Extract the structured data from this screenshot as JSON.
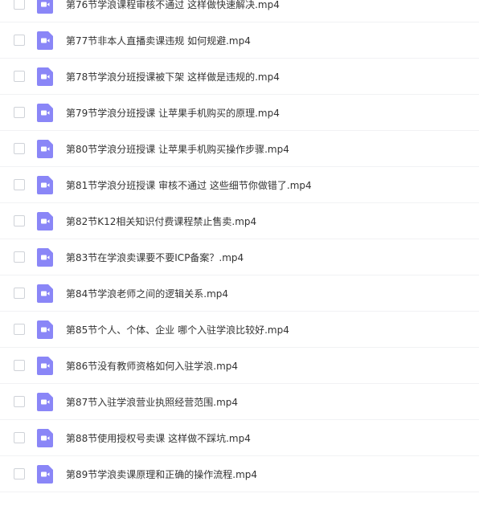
{
  "colors": {
    "icon_bg": "#8a86f7",
    "icon_fg": "#ffffff",
    "text": "#333333",
    "checkbox_border": "#cfd2d8",
    "row_divider": "#f1f2f4"
  },
  "file_icon": "video-file-icon",
  "files": [
    {
      "name": "第76节学浪课程审核不通过 这样做快速解决.mp4"
    },
    {
      "name": "第77节非本人直播卖课违规 如何规避.mp4"
    },
    {
      "name": "第78节学浪分班授课被下架 这样做是违规的.mp4"
    },
    {
      "name": "第79节学浪分班授课 让苹果手机购买的原理.mp4"
    },
    {
      "name": "第80节学浪分班授课 让苹果手机购买操作步骤.mp4"
    },
    {
      "name": "第81节学浪分班授课 审核不通过 这些细节你做错了.mp4"
    },
    {
      "name": "第82节K12相关知识付费课程禁止售卖.mp4"
    },
    {
      "name": "第83节在学浪卖课要不要ICP备案？.mp4"
    },
    {
      "name": "第84节学浪老师之间的逻辑关系.mp4"
    },
    {
      "name": "第85节个人、个体、企业 哪个入驻学浪比较好.mp4"
    },
    {
      "name": "第86节没有教师资格如何入驻学浪.mp4"
    },
    {
      "name": "第87节入驻学浪营业执照经营范围.mp4"
    },
    {
      "name": "第88节使用授权号卖课 这样做不踩坑.mp4"
    },
    {
      "name": "第89节学浪卖课原理和正确的操作流程.mp4"
    }
  ]
}
